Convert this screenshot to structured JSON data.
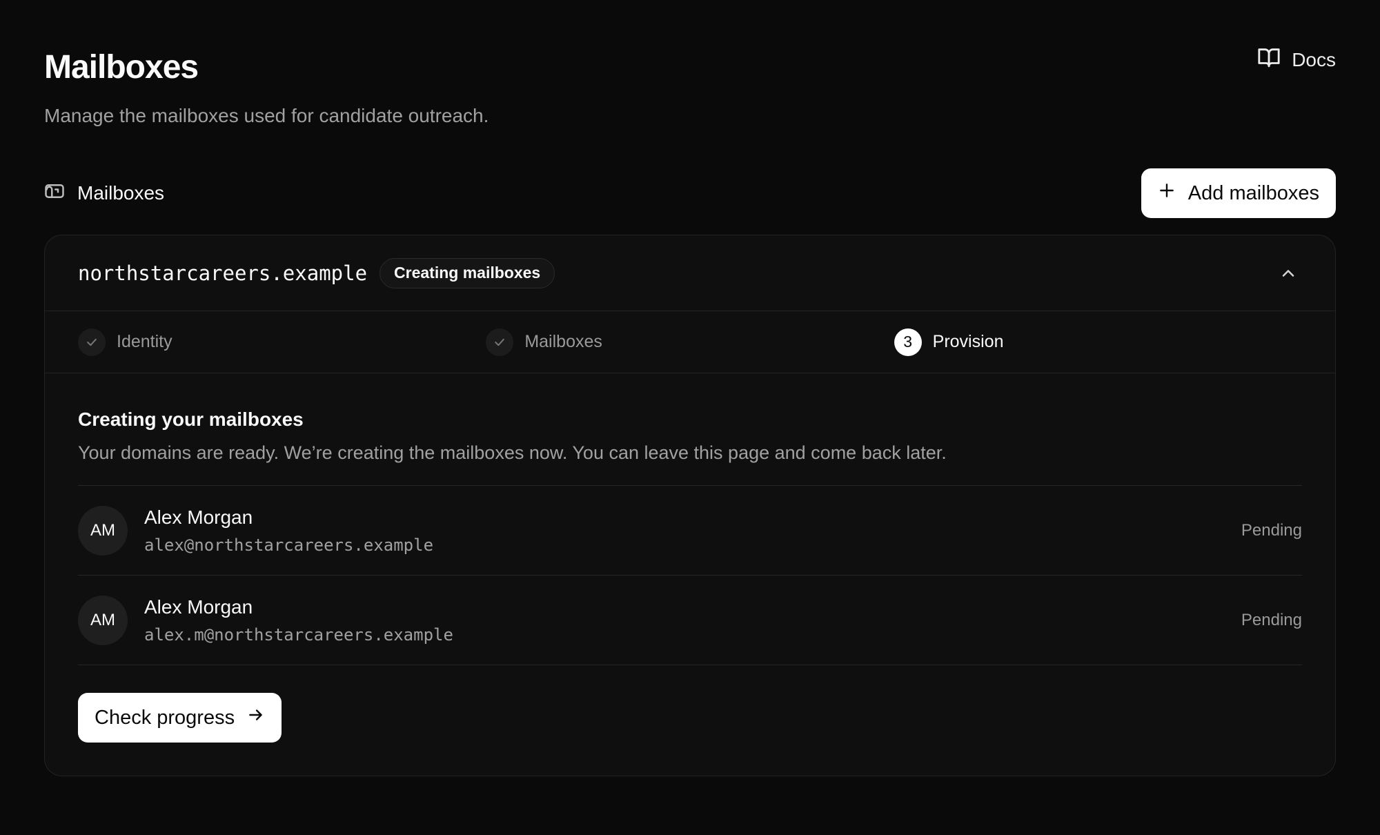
{
  "header": {
    "title": "Mailboxes",
    "subtitle": "Manage the mailboxes used for candidate outreach.",
    "docs_label": "Docs",
    "docs_icon": "book-open-icon"
  },
  "section": {
    "label": "Mailboxes",
    "icon": "mailbox-icon",
    "add_button_label": "Add mailboxes",
    "add_button_icon": "plus-icon"
  },
  "domain_card": {
    "domain": "northstarcareers.example",
    "status": "Creating mailboxes",
    "collapse_icon": "chevron-up-icon",
    "steps": [
      {
        "label": "Identity",
        "state": "complete",
        "marker": ""
      },
      {
        "label": "Mailboxes",
        "state": "complete",
        "marker": ""
      },
      {
        "label": "Provision",
        "state": "active",
        "marker": "3"
      }
    ],
    "body": {
      "title": "Creating your mailboxes",
      "description": "Your domains are ready. We’re creating the mailboxes now. You can leave this page and come back later."
    },
    "mailboxes": [
      {
        "initials": "AM",
        "name": "Alex Morgan",
        "email": "alex@northstarcareers.example",
        "status": "Pending"
      },
      {
        "initials": "AM",
        "name": "Alex Morgan",
        "email": "alex.m@northstarcareers.example",
        "status": "Pending"
      }
    ],
    "check_button_label": "Check progress",
    "check_button_icon": "arrow-right-icon"
  },
  "colors": {
    "background": "#0a0a0a",
    "card": "#0f0f0f",
    "border": "#232323",
    "primary_button": "#ffffff",
    "muted_text": "#a1a1a1"
  }
}
